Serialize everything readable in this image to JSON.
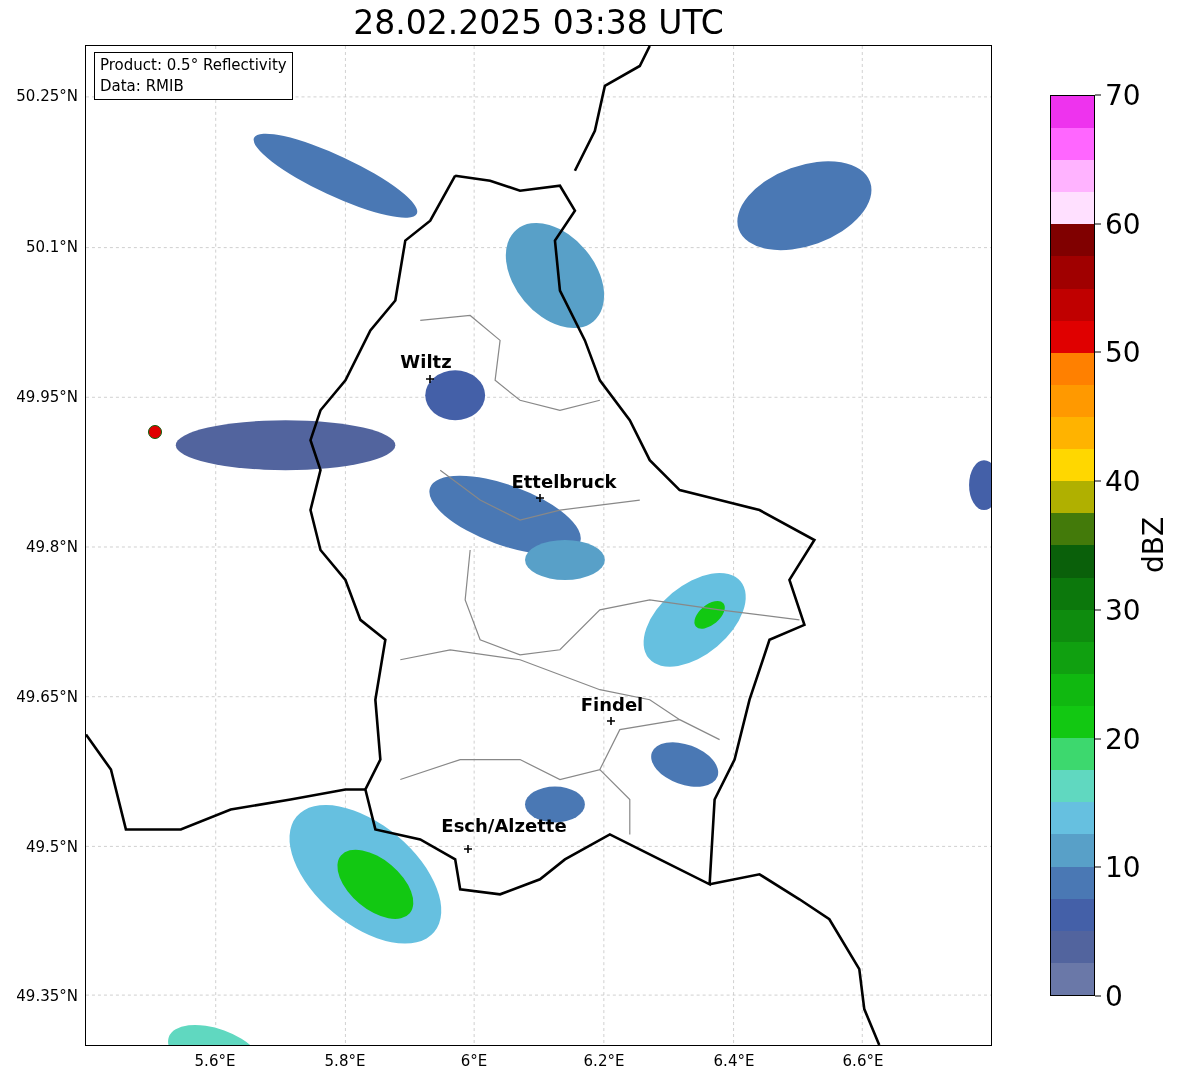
{
  "title": "28.02.2025 03:38 UTC",
  "info_box": {
    "lines": [
      "Product: 0.5° Reflectivity",
      "Data: RMIB"
    ]
  },
  "map": {
    "lat_ticks": [
      "50.25°N",
      "50.1°N",
      "49.95°N",
      "49.8°N",
      "49.65°N",
      "49.5°N",
      "49.35°N"
    ],
    "lon_ticks": [
      "5.6°E",
      "5.8°E",
      "6°E",
      "6.2°E",
      "6.4°E",
      "6.6°E"
    ],
    "cities": [
      {
        "name": "Wiltz"
      },
      {
        "name": "Ettelbruck"
      },
      {
        "name": "Findel"
      },
      {
        "name": "Esch/Alzette"
      }
    ]
  },
  "colorbar": {
    "label": "dBZ",
    "ticks": [
      "70",
      "60",
      "50",
      "40",
      "30",
      "20",
      "10",
      "0"
    ],
    "segments": [
      {
        "color": "#6a78a8"
      },
      {
        "color": "#52649e"
      },
      {
        "color": "#4460a8"
      },
      {
        "color": "#4a78b4"
      },
      {
        "color": "#58a0c8"
      },
      {
        "color": "#66c0e0"
      },
      {
        "color": "#60d8c0"
      },
      {
        "color": "#3dd86e"
      },
      {
        "color": "#12c812"
      },
      {
        "color": "#10b810"
      },
      {
        "color": "#10a010"
      },
      {
        "color": "#0e8c0e"
      },
      {
        "color": "#0c780c"
      },
      {
        "color": "#0a600a"
      },
      {
        "color": "#437a0a"
      },
      {
        "color": "#b0b000"
      },
      {
        "color": "#ffd700"
      },
      {
        "color": "#ffb300"
      },
      {
        "color": "#ff9900"
      },
      {
        "color": "#ff8000"
      },
      {
        "color": "#e00000"
      },
      {
        "color": "#c00000"
      },
      {
        "color": "#a00000"
      },
      {
        "color": "#800000"
      },
      {
        "color": "#ffe0ff"
      },
      {
        "color": "#ffb3ff"
      },
      {
        "color": "#ff66ff"
      },
      {
        "color": "#ee33ee"
      }
    ]
  }
}
